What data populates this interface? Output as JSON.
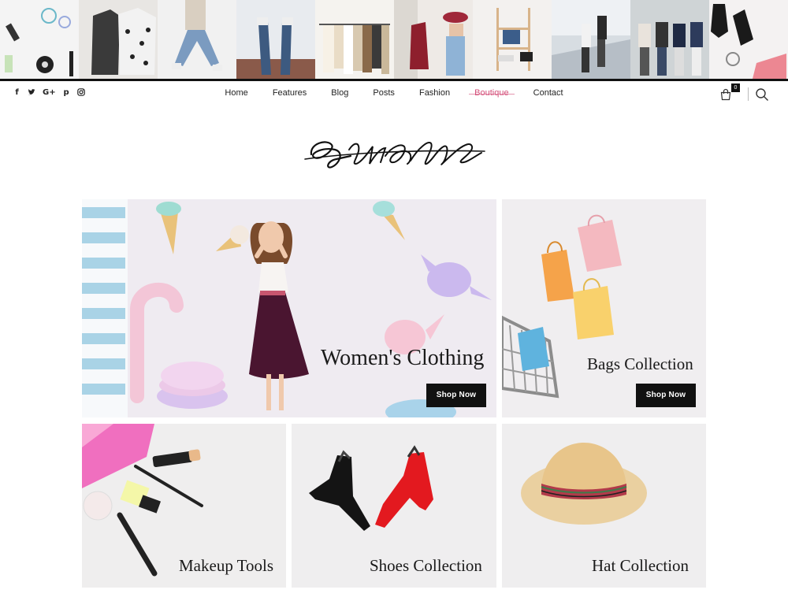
{
  "strip": {
    "tiles": [
      "makeup-flatlay",
      "sweaters",
      "jumping-jeans",
      "legs-sofa",
      "clothes-rack",
      "red-jacket-hat",
      "ladder-shelf",
      "city-walk",
      "friends-walking",
      "boots-accessories"
    ]
  },
  "social": {
    "icons": [
      {
        "name": "facebook-icon",
        "glyph": "f"
      },
      {
        "name": "twitter-icon",
        "glyph": "t"
      },
      {
        "name": "google-plus-icon",
        "glyph": "G+"
      },
      {
        "name": "pinterest-icon",
        "glyph": "p"
      },
      {
        "name": "instagram-icon",
        "glyph": "◎"
      }
    ]
  },
  "menu": {
    "items": [
      "Home",
      "Features",
      "Blog",
      "Posts",
      "Fashion",
      "Boutique",
      "Contact"
    ],
    "active": "Boutique"
  },
  "cart": {
    "count": "0"
  },
  "colors": {
    "accent": "#d4507a",
    "button": "#111111"
  },
  "cards": {
    "women": {
      "title": "Women's Clothing",
      "button": "Shop Now"
    },
    "bags": {
      "title": "Bags Collection",
      "button": "Shop Now"
    },
    "makeup": {
      "title": "Makeup Tools"
    },
    "shoes": {
      "title": "Shoes Collection"
    },
    "hat": {
      "title": "Hat Collection"
    }
  }
}
